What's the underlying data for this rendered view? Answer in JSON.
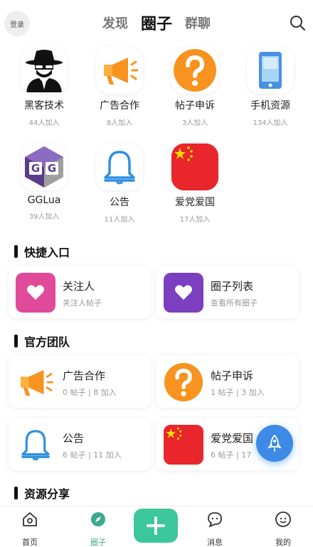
{
  "topbar": {
    "login_label": "登录",
    "tabs": [
      {
        "label": "发现",
        "active": false
      },
      {
        "label": "圈子",
        "active": true
      },
      {
        "label": "群聊",
        "active": false
      }
    ]
  },
  "circles": [
    {
      "name": "黑客技术",
      "count": "44人加入",
      "icon": "hacker-icon"
    },
    {
      "name": "广告合作",
      "count": "8人加入",
      "icon": "megaphone-icon"
    },
    {
      "name": "帖子申诉",
      "count": "3人加入",
      "icon": "question-icon"
    },
    {
      "name": "手机资源",
      "count": "134人加入",
      "icon": "phone-icon"
    },
    {
      "name": "GGLua",
      "count": "39人加入",
      "icon": "gg-icon"
    },
    {
      "name": "公告",
      "count": "11人加入",
      "icon": "bell-icon"
    },
    {
      "name": "爱党爱国",
      "count": "17人加入",
      "icon": "flag-icon"
    }
  ],
  "sections": {
    "quick_entry": "快捷入口",
    "official_team": "官方团队",
    "resource_share": "资源分享"
  },
  "quick_cards": [
    {
      "title": "关注人",
      "sub": "关注人帖子",
      "color": "#e04a9a"
    },
    {
      "title": "圈子列表",
      "sub": "查看所有圈子",
      "color": "#7b3fc0"
    }
  ],
  "team_cards": [
    {
      "title": "广告合作",
      "sub": "0 帖子 | 8 加入",
      "icon": "megaphone-icon"
    },
    {
      "title": "帖子申诉",
      "sub": "1 帖子 | 3 加入",
      "icon": "question-icon"
    },
    {
      "title": "公告",
      "sub": "6 帖子 | 11 加入",
      "icon": "bell-icon"
    },
    {
      "title": "爱党爱国",
      "sub": "6 帖子 | 17",
      "icon": "flag-icon"
    }
  ],
  "bottom_nav": [
    {
      "label": "首页",
      "icon": "home-icon",
      "active": false
    },
    {
      "label": "圈子",
      "icon": "compass-icon",
      "active": true
    },
    {
      "label": "消息",
      "icon": "message-icon",
      "active": false
    },
    {
      "label": "我的",
      "icon": "profile-icon",
      "active": false
    }
  ],
  "colors": {
    "accent": "#3cc79a",
    "float_button": "#3d8be6",
    "orange": "#f7931e",
    "red": "#e8262c"
  }
}
